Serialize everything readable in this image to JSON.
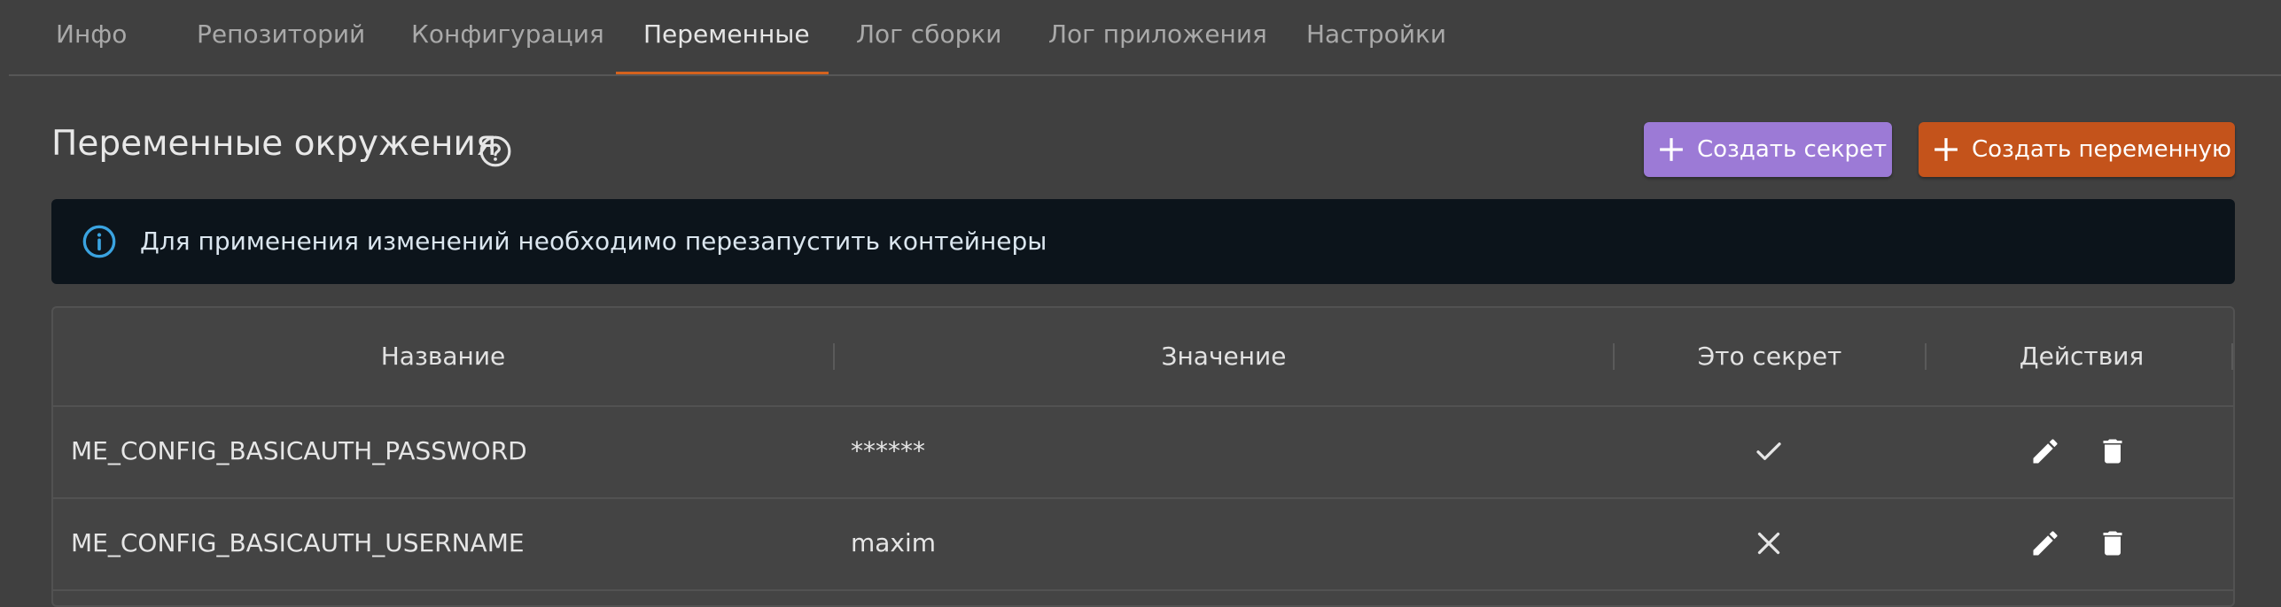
{
  "tabs": [
    {
      "label": "Инфо",
      "active": false
    },
    {
      "label": "Репозиторий",
      "active": false
    },
    {
      "label": "Конфигурация",
      "active": false
    },
    {
      "label": "Переменные",
      "active": true
    },
    {
      "label": "Лог сборки",
      "active": false
    },
    {
      "label": "Лог приложения",
      "active": false
    },
    {
      "label": "Настройки",
      "active": false
    }
  ],
  "page": {
    "title": "Переменные окружения",
    "help_icon": "help-circle-icon"
  },
  "buttons": {
    "create_secret": "Создать секрет",
    "create_variable": "Создать переменную",
    "icon": "plus-icon"
  },
  "alert": {
    "icon": "info-icon",
    "text": "Для применения изменений необходимо перезапустить контейнеры"
  },
  "table": {
    "headers": [
      "Название",
      "Значение",
      "Это секрет",
      "Действия"
    ],
    "rows": [
      {
        "name": "ME_CONFIG_BASICAUTH_PASSWORD",
        "value": "******",
        "is_secret": true
      },
      {
        "name": "ME_CONFIG_BASICAUTH_USERNAME",
        "value": "maxim",
        "is_secret": false
      }
    ],
    "action_icons": [
      "pencil-icon",
      "trash-icon"
    ]
  },
  "colors": {
    "background": "#404040",
    "accent": "#d4621e",
    "secret_button": "#9c7ad6",
    "variable_button": "#c4531b",
    "alert_background": "#0c141b",
    "info_icon": "#3aa3e0"
  }
}
